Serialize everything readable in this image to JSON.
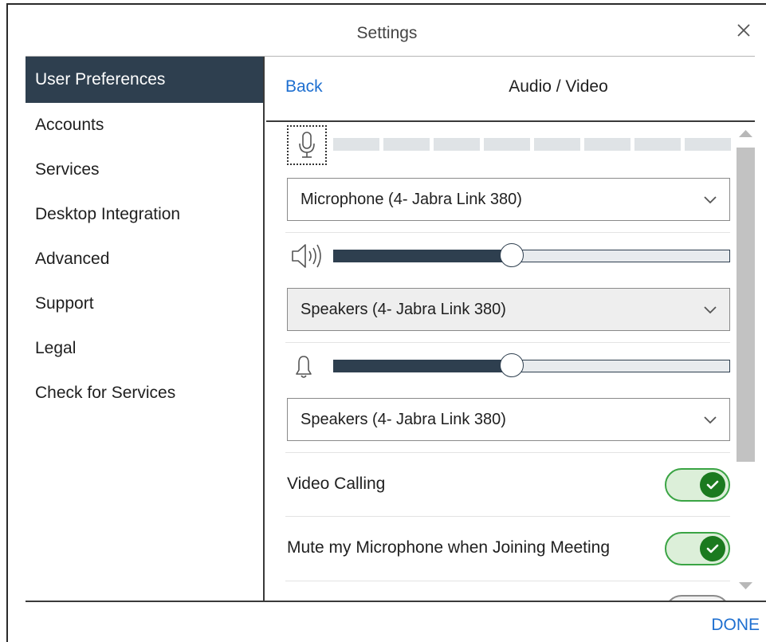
{
  "window": {
    "title": "Settings"
  },
  "sidebar": {
    "items": [
      {
        "label": "User Preferences",
        "active": true
      },
      {
        "label": "Accounts"
      },
      {
        "label": "Services"
      },
      {
        "label": "Desktop Integration"
      },
      {
        "label": "Advanced"
      },
      {
        "label": "Support"
      },
      {
        "label": "Legal"
      },
      {
        "label": "Check for Services"
      }
    ]
  },
  "header": {
    "back_label": "Back",
    "title": "Audio / Video"
  },
  "audio": {
    "microphone_select": "Microphone (4- Jabra Link 380)",
    "speaker_volume_percent": 45,
    "speaker_select": "Speakers (4- Jabra Link 380)",
    "ringer_volume_percent": 45,
    "ringer_select": "Speakers (4- Jabra Link 380)"
  },
  "toggles": [
    {
      "label": "Video Calling",
      "on": true
    },
    {
      "label": "Mute my Microphone when Joining Meeting",
      "on": true
    }
  ],
  "footer": {
    "done_label": "DONE"
  },
  "colors": {
    "accent": "#1e6fd0",
    "sidebar_active": "#2e3f4f",
    "toggle_on": "#1b7a1f"
  },
  "icons": [
    "close-icon",
    "microphone-icon",
    "speaker-volume-icon",
    "bell-icon",
    "chevron-down-icon",
    "check-icon",
    "scroll-up-arrow-icon",
    "scroll-down-arrow-icon"
  ]
}
